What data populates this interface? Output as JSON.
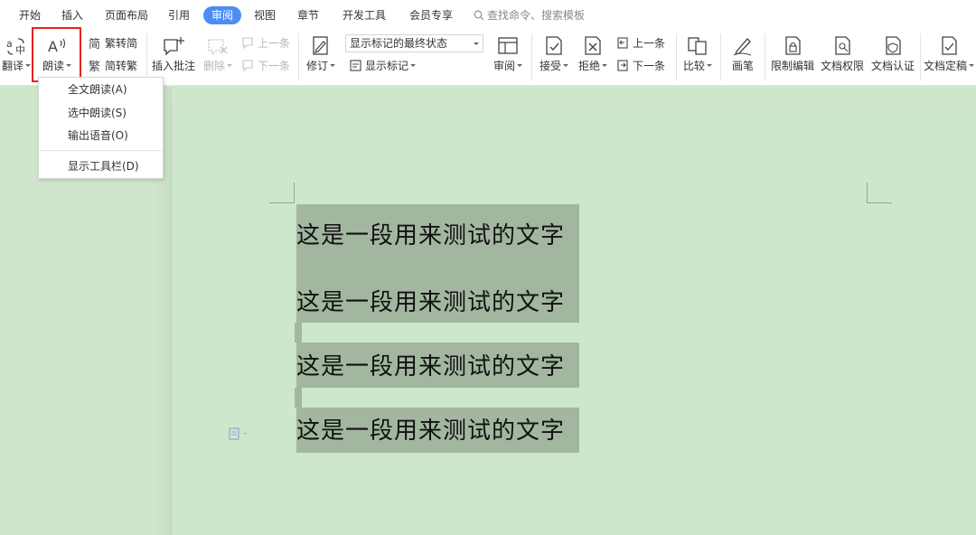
{
  "tabs": [
    "开始",
    "插入",
    "页面布局",
    "引用",
    "审阅",
    "视图",
    "章节",
    "开发工具",
    "会员专享"
  ],
  "active_tab": "审阅",
  "search": {
    "placeholder": "查找命令、搜索模板",
    "icon": "search-icon"
  },
  "ribbon": {
    "translate": "翻译",
    "read_aloud": "朗读",
    "trad_to_simp": "繁转简",
    "simp_to_trad": "简转繁",
    "insert_comment": "插入批注",
    "delete": "删除",
    "prev_comment": "上一条",
    "next_comment": "下一条",
    "revise": "修订",
    "markup_mode": "显示标记的最终状态",
    "show_markup": "显示标记",
    "review": "审阅",
    "accept": "接受",
    "reject": "拒绝",
    "prev_change": "上一条",
    "next_change": "下一条",
    "compare": "比较",
    "pen": "画笔",
    "restrict_edit": "限制编辑",
    "doc_permission": "文档权限",
    "doc_certify": "文档认证",
    "doc_finalize": "文档定稿"
  },
  "dropdown": {
    "items": [
      "全文朗读(A)",
      "选中朗读(S)",
      "输出语音(O)",
      "显示工具栏(D)"
    ]
  },
  "document": {
    "lines": [
      "这是一段用来测试的文字",
      "这是一段用来测试的文字",
      "这是一段用来测试的文字",
      "这是一段用来测试的文字"
    ]
  },
  "colors": {
    "accent": "#4d8cf5",
    "highlight_border": "#e1261c",
    "page_bg": "#cce7cc",
    "selection": "#a3b7a0"
  }
}
